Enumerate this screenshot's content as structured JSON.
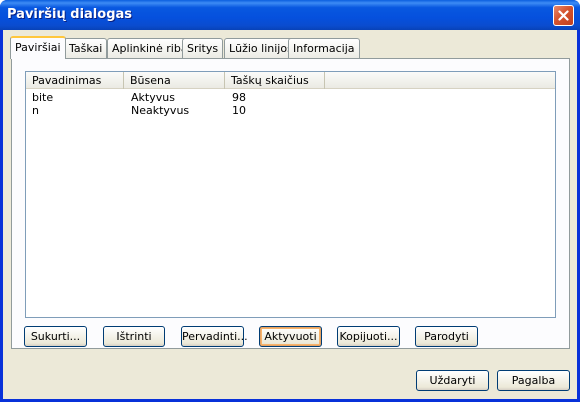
{
  "window": {
    "title": "Paviršių dialogas"
  },
  "tabs": [
    {
      "label": "Paviršiai",
      "active": true
    },
    {
      "label": "Taškai"
    },
    {
      "label": "Aplinkinė riba"
    },
    {
      "label": "Sritys"
    },
    {
      "label": "Lūžio linijos"
    },
    {
      "label": "Informacija"
    }
  ],
  "list": {
    "columns": [
      "Pavadinimas",
      "Būsena",
      "Taškų skaičius"
    ],
    "rows": [
      [
        "bite",
        "Aktyvus",
        "98"
      ],
      [
        "n",
        "Neaktyvus",
        "10"
      ]
    ]
  },
  "actions": {
    "create": "Sukurti...",
    "delete": "Ištrinti",
    "rename": "Pervadinti...",
    "activate": "Aktyvuoti",
    "copy": "Kopijuoti...",
    "show": "Parodyti"
  },
  "footer": {
    "close": "Uždaryti",
    "help": "Pagalba"
  },
  "colors": {
    "titlebar": "#0550dd",
    "face": "#ece9d8",
    "tab_accent": "#ffc73c"
  },
  "icons": {
    "close": "close-icon"
  }
}
